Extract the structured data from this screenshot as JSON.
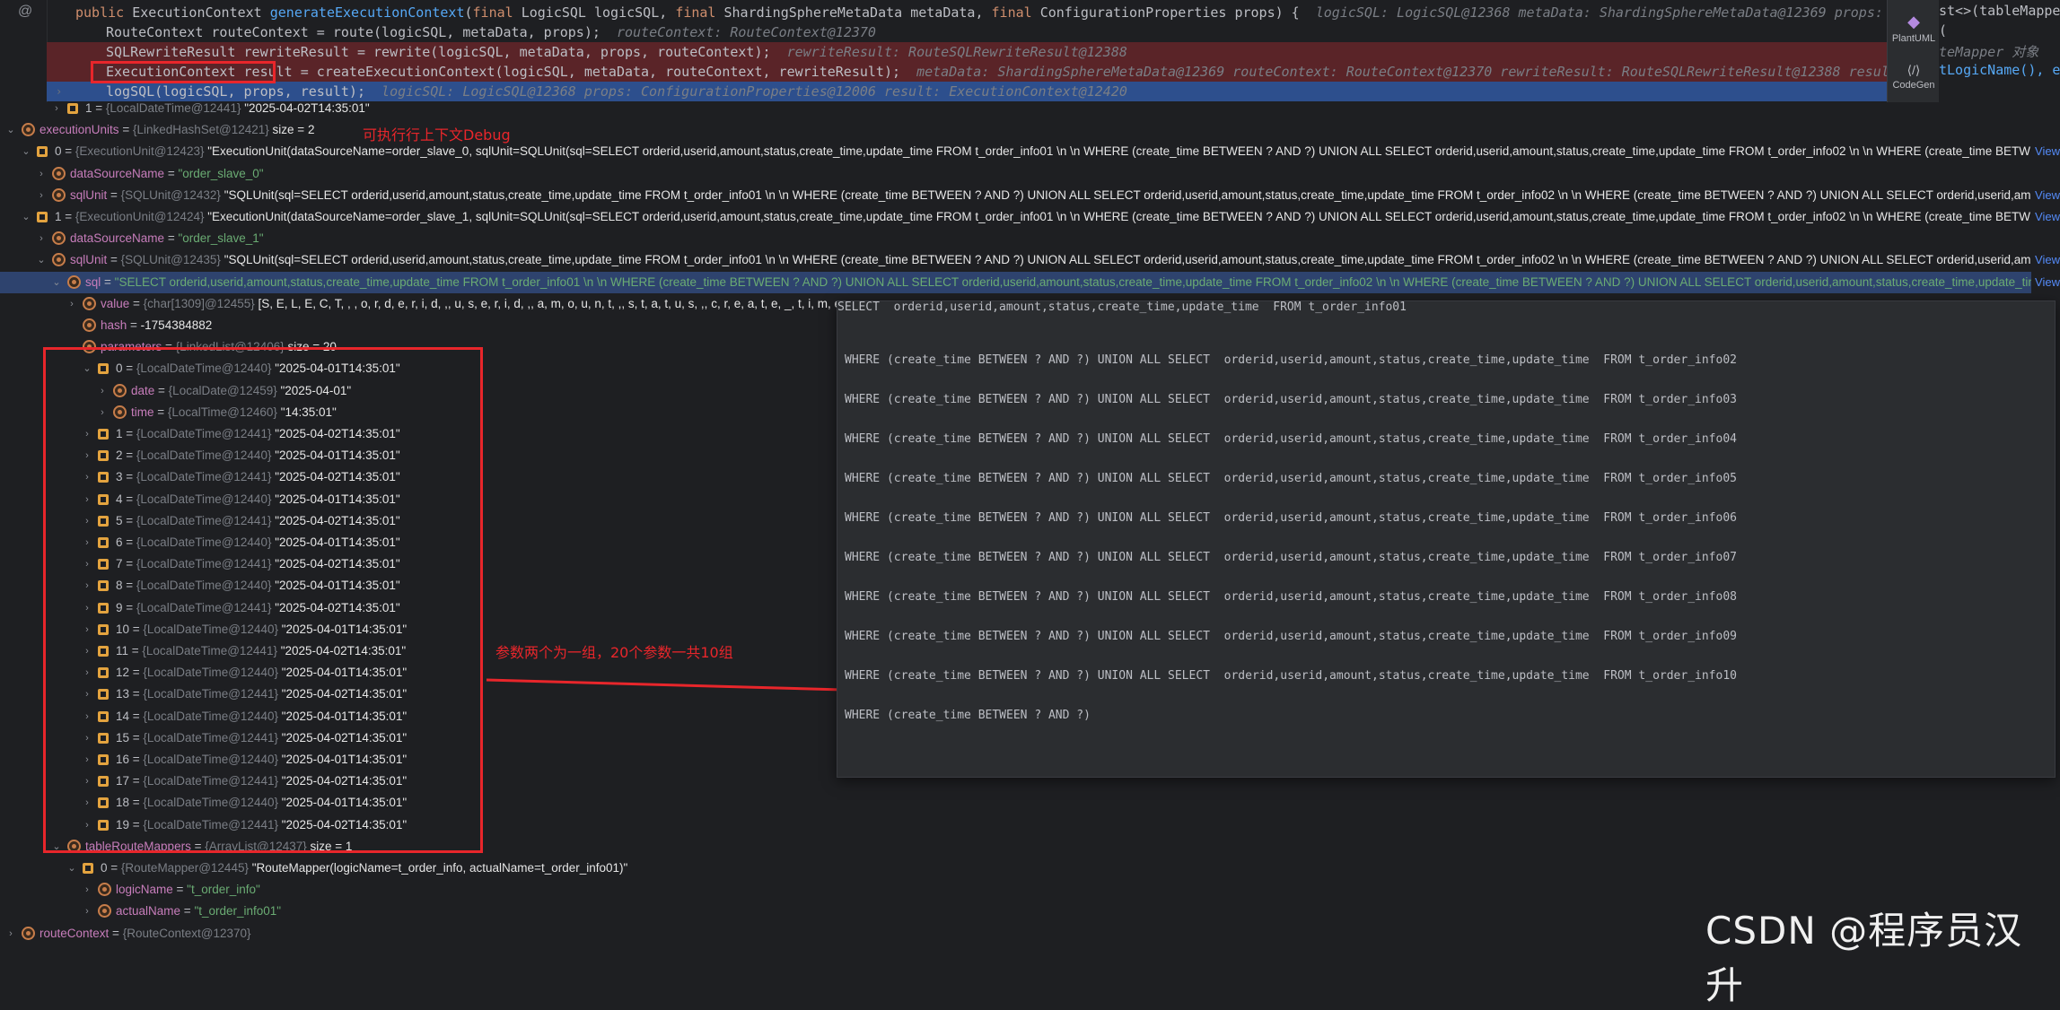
{
  "editor": {
    "lines": [
      {
        "code_html": "<span class=\"kw\">public</span> ExecutionContext <span class=\"fn\">generateExecutionContext</span>(<span class=\"kw\">final</span> LogicSQL logicSQL, <span class=\"kw\">final</span> ShardingSphereMetaData metaData, <span class=\"kw\">final</span> ConfigurationProperties props) {",
        "hint": "logicSQL: LogicSQL@12368    metaData: ShardingSphereMetaData@12369    props: ConfigurationProperti"
      },
      {
        "code_html": "RouteContext routeContext = route(logicSQL, metaData, props);",
        "hint": "routeContext: RouteContext@12370"
      },
      {
        "code_html": "SQLRewriteResult rewriteResult = rewrite(logicSQL, metaData, props, routeContext);",
        "hint": "rewriteResult: RouteSQLRewriteResult@12388"
      },
      {
        "code_html": "ExecutionContext result = createExecutionContext(logicSQL, metaData, routeContext, rewriteResult);",
        "hint": "metaData: ShardingSphereMetaData@12369    routeContext: RouteContext@12370    rewriteResult: RouteSQLRewriteResult@12388    result: ExecutionConte"
      },
      {
        "code_html": "logSQL(logicSQL, props, result);",
        "hint": "logicSQL: LogicSQL@12368    props: ConfigurationProperties@12006    result: ExecutionContext@12420"
      }
    ],
    "right_overflow": [
      "st<>(tableMappers",
      "(",
      "teMapper 对象",
      "tLogicName(), eac",
      ""
    ],
    "tools": [
      {
        "icon": "◆",
        "label": "PlantUML"
      },
      {
        "icon": "⟨/⟩",
        "label": "CodeGen"
      }
    ]
  },
  "annotations": {
    "debug_note": "可执行行上下文Debug",
    "params_note": "参数两个为一组，20个参数一共10组"
  },
  "variables": [
    {
      "depth": 3,
      "chev": "›",
      "icon": "sq",
      "name": "1",
      "type": "{LocalDateTime@12441}",
      "value": "\"2025-04-02T14:35:01\""
    },
    {
      "depth": 0,
      "chev": "⌄",
      "icon": "f",
      "name": "executionUnits",
      "type": "{LinkedHashSet@12421}",
      "value": "size = 2"
    },
    {
      "depth": 1,
      "chev": "⌄",
      "icon": "sq",
      "name": "0",
      "type": "{ExecutionUnit@12423}",
      "value": "\"ExecutionUnit(dataSourceName=order_slave_0, sqlUnit=SQLUnit(sql=SELECT  orderid,userid,amount,status,create_time,update_time  FROM t_order_info01 \\n \\n WHERE (create_time BETWEEN ? AND ?) UNION ALL SELECT  orderid,userid,amount,status,create_time,update_time  FROM t_order_info02 \\n \\n WHERE (create_time BETWEEN ? AND ?) UNIO...",
      "link": "View"
    },
    {
      "depth": 2,
      "chev": "›",
      "icon": "f",
      "name": "dataSourceName",
      "type": "",
      "value": "\"order_slave_0\"",
      "green": true
    },
    {
      "depth": 2,
      "chev": "›",
      "icon": "f",
      "name": "sqlUnit",
      "type": "{SQLUnit@12432}",
      "value": "\"SQLUnit(sql=SELECT  orderid,userid,amount,status,create_time,update_time  FROM t_order_info01 \\n \\n WHERE (create_time BETWEEN ? AND ?) UNION ALL SELECT  orderid,userid,amount,status,create_time,update_time  FROM t_order_info02 \\n \\n WHERE (create_time BETWEEN ? AND ?) UNION ALL SELECT  orderid,userid,amount,status,create_ti...",
      "link": "View"
    },
    {
      "depth": 1,
      "chev": "⌄",
      "icon": "sq",
      "name": "1",
      "type": "{ExecutionUnit@12424}",
      "value": "\"ExecutionUnit(dataSourceName=order_slave_1, sqlUnit=SQLUnit(sql=SELECT  orderid,userid,amount,status,create_time,update_time  FROM t_order_info01 \\n \\n WHERE (create_time BETWEEN ? AND ?) UNION ALL SELECT  orderid,userid,amount,status,create_time,update_time  FROM t_order_info02 \\n \\n WHERE (create_time BETWEEN ? AND ?) UNIO...",
      "link": "View"
    },
    {
      "depth": 2,
      "chev": "›",
      "icon": "f",
      "name": "dataSourceName",
      "type": "",
      "value": "\"order_slave_1\"",
      "green": true
    },
    {
      "depth": 2,
      "chev": "⌄",
      "icon": "f",
      "name": "sqlUnit",
      "type": "{SQLUnit@12435}",
      "value": "\"SQLUnit(sql=SELECT  orderid,userid,amount,status,create_time,update_time  FROM t_order_info01 \\n \\n WHERE (create_time BETWEEN ? AND ?) UNION ALL SELECT  orderid,userid,amount,status,create_time,update_time  FROM t_order_info02 \\n \\n WHERE (create_time BETWEEN ? AND ?) UNION ALL SELECT  orderid,userid,amount,status,create_ti...",
      "link": "View"
    },
    {
      "depth": 3,
      "chev": "⌄",
      "icon": "f",
      "name": "sql",
      "type": "",
      "value": "\"SELECT  orderid,userid,amount,status,create_time,update_time  FROM t_order_info01 \\n \\n WHERE (create_time BETWEEN ? AND ?) UNION ALL SELECT  orderid,userid,amount,status,create_time,update_time  FROM t_order_info02 \\n \\n WHERE (create_time BETWEEN ? AND ?) UNION ALL SELECT  orderid,userid,amount,status,create_time,update_time  FROM t_order...",
      "link": "View",
      "selected": true,
      "green": true
    },
    {
      "depth": 4,
      "chev": "›",
      "icon": "f",
      "name": "value",
      "type": "{char[1309]@12455}",
      "value": "[S, E, L, E, C, T,  ,  , o, r, d, e, r, i, d, ,, u, s, e, r, i, d, ,, a, m, o, u, n, t, ,, s, t, a, t, u, s, ,, c, r, e, a, t, e, _, t, i, m, e, ,, u,"
    },
    {
      "depth": 4,
      "chev": "",
      "icon": "f",
      "name": "hash",
      "type": "",
      "value": "-1754384882"
    },
    {
      "depth": 4,
      "chev": "⌄",
      "icon": "f",
      "name": "parameters",
      "type": "{LinkedList@12406}",
      "value": "size = 20"
    },
    {
      "depth": 5,
      "chev": "⌄",
      "icon": "sq",
      "name": "0",
      "type": "{LocalDateTime@12440}",
      "value": "\"2025-04-01T14:35:01\""
    },
    {
      "depth": 6,
      "chev": "›",
      "icon": "f",
      "name": "date",
      "type": "{LocalDate@12459}",
      "value": "\"2025-04-01\""
    },
    {
      "depth": 6,
      "chev": "›",
      "icon": "f",
      "name": "time",
      "type": "{LocalTime@12460}",
      "value": "\"14:35:01\""
    },
    {
      "depth": 5,
      "chev": "›",
      "icon": "sq",
      "name": "1",
      "type": "{LocalDateTime@12441}",
      "value": "\"2025-04-02T14:35:01\""
    },
    {
      "depth": 5,
      "chev": "›",
      "icon": "sq",
      "name": "2",
      "type": "{LocalDateTime@12440}",
      "value": "\"2025-04-01T14:35:01\""
    },
    {
      "depth": 5,
      "chev": "›",
      "icon": "sq",
      "name": "3",
      "type": "{LocalDateTime@12441}",
      "value": "\"2025-04-02T14:35:01\""
    },
    {
      "depth": 5,
      "chev": "›",
      "icon": "sq",
      "name": "4",
      "type": "{LocalDateTime@12440}",
      "value": "\"2025-04-01T14:35:01\""
    },
    {
      "depth": 5,
      "chev": "›",
      "icon": "sq",
      "name": "5",
      "type": "{LocalDateTime@12441}",
      "value": "\"2025-04-02T14:35:01\""
    },
    {
      "depth": 5,
      "chev": "›",
      "icon": "sq",
      "name": "6",
      "type": "{LocalDateTime@12440}",
      "value": "\"2025-04-01T14:35:01\""
    },
    {
      "depth": 5,
      "chev": "›",
      "icon": "sq",
      "name": "7",
      "type": "{LocalDateTime@12441}",
      "value": "\"2025-04-02T14:35:01\""
    },
    {
      "depth": 5,
      "chev": "›",
      "icon": "sq",
      "name": "8",
      "type": "{LocalDateTime@12440}",
      "value": "\"2025-04-01T14:35:01\""
    },
    {
      "depth": 5,
      "chev": "›",
      "icon": "sq",
      "name": "9",
      "type": "{LocalDateTime@12441}",
      "value": "\"2025-04-02T14:35:01\""
    },
    {
      "depth": 5,
      "chev": "›",
      "icon": "sq",
      "name": "10",
      "type": "{LocalDateTime@12440}",
      "value": "\"2025-04-01T14:35:01\""
    },
    {
      "depth": 5,
      "chev": "›",
      "icon": "sq",
      "name": "11",
      "type": "{LocalDateTime@12441}",
      "value": "\"2025-04-02T14:35:01\""
    },
    {
      "depth": 5,
      "chev": "›",
      "icon": "sq",
      "name": "12",
      "type": "{LocalDateTime@12440}",
      "value": "\"2025-04-01T14:35:01\""
    },
    {
      "depth": 5,
      "chev": "›",
      "icon": "sq",
      "name": "13",
      "type": "{LocalDateTime@12441}",
      "value": "\"2025-04-02T14:35:01\""
    },
    {
      "depth": 5,
      "chev": "›",
      "icon": "sq",
      "name": "14",
      "type": "{LocalDateTime@12440}",
      "value": "\"2025-04-01T14:35:01\""
    },
    {
      "depth": 5,
      "chev": "›",
      "icon": "sq",
      "name": "15",
      "type": "{LocalDateTime@12441}",
      "value": "\"2025-04-02T14:35:01\""
    },
    {
      "depth": 5,
      "chev": "›",
      "icon": "sq",
      "name": "16",
      "type": "{LocalDateTime@12440}",
      "value": "\"2025-04-01T14:35:01\""
    },
    {
      "depth": 5,
      "chev": "›",
      "icon": "sq",
      "name": "17",
      "type": "{LocalDateTime@12441}",
      "value": "\"2025-04-02T14:35:01\""
    },
    {
      "depth": 5,
      "chev": "›",
      "icon": "sq",
      "name": "18",
      "type": "{LocalDateTime@12440}",
      "value": "\"2025-04-01T14:35:01\""
    },
    {
      "depth": 5,
      "chev": "›",
      "icon": "sq",
      "name": "19",
      "type": "{LocalDateTime@12441}",
      "value": "\"2025-04-02T14:35:01\""
    },
    {
      "depth": 3,
      "chev": "⌄",
      "icon": "f",
      "name": "tableRouteMappers",
      "type": "{ArrayList@12437}",
      "value": "size = 1"
    },
    {
      "depth": 4,
      "chev": "⌄",
      "icon": "sq",
      "name": "0",
      "type": "{RouteMapper@12445}",
      "value": "\"RouteMapper(logicName=t_order_info, actualName=t_order_info01)\""
    },
    {
      "depth": 5,
      "chev": "›",
      "icon": "f",
      "name": "logicName",
      "type": "",
      "value": "\"t_order_info\"",
      "green": true
    },
    {
      "depth": 5,
      "chev": "›",
      "icon": "f",
      "name": "actualName",
      "type": "",
      "value": "\"t_order_info01\"",
      "green": true
    },
    {
      "depth": 0,
      "chev": "›",
      "icon": "f",
      "name": "routeContext",
      "type": "{RouteContext@12370}",
      "value": ""
    }
  ],
  "sql_popup": [
    "SELECT  orderid,userid,amount,status,create_time,update_time  FROM t_order_info01",
    "",
    "WHERE (create_time BETWEEN ? AND ?) UNION ALL SELECT  orderid,userid,amount,status,create_time,update_time  FROM t_order_info02",
    "",
    "WHERE (create_time BETWEEN ? AND ?) UNION ALL SELECT  orderid,userid,amount,status,create_time,update_time  FROM t_order_info03",
    "",
    "WHERE (create_time BETWEEN ? AND ?) UNION ALL SELECT  orderid,userid,amount,status,create_time,update_time  FROM t_order_info04",
    "",
    "WHERE (create_time BETWEEN ? AND ?) UNION ALL SELECT  orderid,userid,amount,status,create_time,update_time  FROM t_order_info05",
    "",
    "WHERE (create_time BETWEEN ? AND ?) UNION ALL SELECT  orderid,userid,amount,status,create_time,update_time  FROM t_order_info06",
    "",
    "WHERE (create_time BETWEEN ? AND ?) UNION ALL SELECT  orderid,userid,amount,status,create_time,update_time  FROM t_order_info07",
    "",
    "WHERE (create_time BETWEEN ? AND ?) UNION ALL SELECT  orderid,userid,amount,status,create_time,update_time  FROM t_order_info08",
    "",
    "WHERE (create_time BETWEEN ? AND ?) UNION ALL SELECT  orderid,userid,amount,status,create_time,update_time  FROM t_order_info09",
    "",
    "WHERE (create_time BETWEEN ? AND ?) UNION ALL SELECT  orderid,userid,amount,status,create_time,update_time  FROM t_order_info10",
    "",
    "WHERE (create_time BETWEEN ? AND ?)"
  ],
  "watermark": "CSDN @程序员汉升"
}
